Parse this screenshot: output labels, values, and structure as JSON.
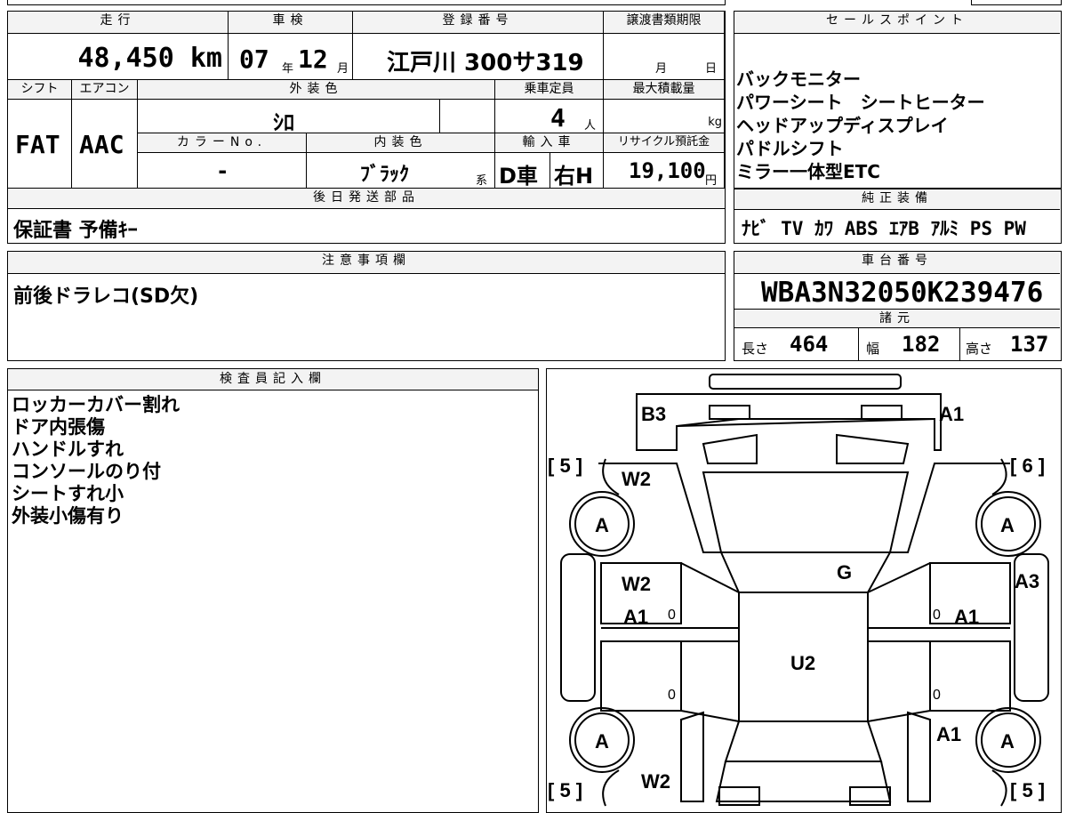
{
  "top": {
    "mileage_label": "走行",
    "mileage_value": "48,450 km",
    "inspection_label": "車検",
    "inspection_year": "07",
    "inspection_year_unit": "年",
    "inspection_month": "12",
    "inspection_month_unit": "月",
    "registration_label": "登録番号",
    "registration_value": "江戸川 300サ319",
    "transfer_label": "譲渡書類期限",
    "transfer_month_unit": "月",
    "transfer_day_unit": "日"
  },
  "spec": {
    "shift_label": "シフト",
    "shift_value": "FAT",
    "aircon_label": "エアコン",
    "aircon_value": "AAC",
    "exterior_label": "外装色",
    "exterior_value": "ｼﾛ",
    "capacity_label": "乗車定員",
    "capacity_value": "4",
    "capacity_unit": "人",
    "maxload_label": "最大積載量",
    "maxload_unit": "kg",
    "colorno_label": "カラーNo.",
    "colorno_value": "-",
    "interior_label": "内装色",
    "interior_value": "ﾌﾞﾗｯｸ",
    "interior_suffix": "系",
    "import_label": "輸入車",
    "import_value": "D車",
    "handle_value": "右H",
    "recycle_label": "リサイクル預託金",
    "recycle_value": "19,100",
    "recycle_unit": "円"
  },
  "sales": {
    "header": "セールスポイント",
    "lines": [
      "バックモニター",
      "パワーシート　シートヒーター",
      "ヘッドアップディスプレイ",
      "パドルシフト",
      "ミラー一体型ETC"
    ]
  },
  "later_parts": {
    "header": "後日発送部品",
    "value": "保証書 予備ｷｰ"
  },
  "genuine": {
    "header": "純正装備",
    "value": "ﾅﾋﾞ TV ｶﾜ ABS ｴｱB ｱﾙﾐ PS PW"
  },
  "notes": {
    "header": "注意事項欄",
    "value": "前後ドラレコ(SD欠)"
  },
  "chassis": {
    "header": "車台番号",
    "value": "WBA3N32050K239476",
    "specs_header": "諸元",
    "length_label": "長さ",
    "length_value": "464",
    "width_label": "幅",
    "width_value": "182",
    "height_label": "高さ",
    "height_value": "137"
  },
  "inspector": {
    "header": "検査員記入欄",
    "lines": [
      "ロッカーカバー割れ",
      "ドア内張傷",
      "ハンドルすれ",
      "コンソールのり付",
      "シートすれ小",
      "外装小傷有り"
    ]
  },
  "diagram": {
    "labels": {
      "b3": "B3",
      "a1_top": "A1",
      "br5_left": "[ 5 ]",
      "br6_right": "[ 6 ]",
      "w2_upper": "W2",
      "tire_fl": "A",
      "tire_fr": "A",
      "g": "G",
      "a3": "A3",
      "w2_mid": "W2",
      "a1_left": "A1",
      "a1_right": "A1",
      "u2": "U2",
      "a1_rear": "A1",
      "tire_rl": "A",
      "tire_rr": "A",
      "br5_bl": "[ 5 ]",
      "w2_bottom": "W2",
      "br5_br": "[ 5 ]",
      "zero_1": "0",
      "zero_2": "0",
      "zero_3": "0",
      "zero_4": "0"
    }
  }
}
